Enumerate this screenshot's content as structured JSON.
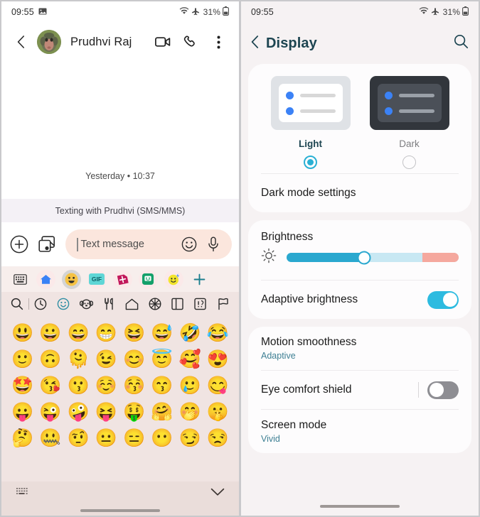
{
  "messages_screen": {
    "status_bar": {
      "time": "09:55",
      "icons": [
        "image-icon",
        "wifi-icon",
        "airplane-icon"
      ],
      "battery_percent": "31%"
    },
    "header": {
      "back_icon": "chevron-left-icon",
      "contact_name": "Prudhvi Raj",
      "avatar": "contact-avatar",
      "actions": [
        "video-call-icon",
        "voice-call-icon",
        "overflow-menu-icon"
      ]
    },
    "thread": {
      "day_separator": "Yesterday • 10:37",
      "sms_banner": "Texting with Prudhvi (SMS/MMS)"
    },
    "compose": {
      "attach_icon": "plus-circle-icon",
      "gallery_icon": "gallery-icon",
      "placeholder": "Text message",
      "emoji_icon": "emoji-face-icon",
      "mic_icon": "microphone-icon"
    },
    "keyboard_toolbar": [
      {
        "name": "keyboard-icon",
        "glyph": "⌨",
        "bg": "transparent",
        "fg": "#2b2b2b",
        "selected": false
      },
      {
        "name": "home-icon",
        "glyph": "⌂",
        "bg": "#fbe9e9",
        "fg": "#3b82f6",
        "selected": false
      },
      {
        "name": "emoji-icon",
        "glyph": "😀",
        "bg": "#d4d4d4",
        "fg": "#000000",
        "selected": true
      },
      {
        "name": "gif-icon",
        "glyph": "GIF",
        "bg": "#fbe9e9",
        "fg": "#1c9aa8",
        "selected": false
      },
      {
        "name": "sticker-icon",
        "glyph": "✿",
        "bg": "#fbe9e9",
        "fg": "#c2185b",
        "selected": false
      },
      {
        "name": "bitmoji-icon",
        "glyph": "☺",
        "bg": "#fbe9e9",
        "fg": "#14a06a",
        "selected": false
      },
      {
        "name": "ai-emoji-icon",
        "glyph": "☻",
        "bg": "#fbe9e9",
        "fg": "#e6c700",
        "selected": false
      },
      {
        "name": "add-icon",
        "glyph": "+",
        "bg": "transparent",
        "fg": "#1c7f8e",
        "selected": false
      }
    ],
    "emoji_categories": [
      {
        "name": "emoji-search-icon",
        "glyph": "search",
        "selected": false
      },
      {
        "name": "recent-icon",
        "glyph": "clock",
        "selected": false
      },
      {
        "name": "smileys-icon",
        "glyph": "smiley",
        "selected": true
      },
      {
        "name": "animals-icon",
        "glyph": "animal",
        "selected": false
      },
      {
        "name": "food-icon",
        "glyph": "food",
        "selected": false
      },
      {
        "name": "travel-icon",
        "glyph": "house",
        "selected": false
      },
      {
        "name": "activities-icon",
        "glyph": "ball",
        "selected": false
      },
      {
        "name": "objects-icon",
        "glyph": "book",
        "selected": false
      },
      {
        "name": "symbols-icon",
        "glyph": "symbols",
        "selected": false
      },
      {
        "name": "flags-icon",
        "glyph": "flag",
        "selected": false
      }
    ],
    "emoji_grid": [
      "😃",
      "😀",
      "😄",
      "😁",
      "😆",
      "😅",
      "🤣",
      "😂",
      "🙂",
      "🙃",
      "🫠",
      "😉",
      "😊",
      "😇",
      "🥰",
      "😍",
      "🤩",
      "😘",
      "😗",
      "☺️",
      "😚",
      "😙",
      "🥲",
      "😋",
      "😛",
      "😜",
      "🤪",
      "😝",
      "🤑",
      "🤗",
      "🤭",
      "🤫",
      "🤔",
      "🤐",
      "🤨",
      "😐",
      "😑",
      "😶",
      "😏",
      "😒"
    ],
    "keyboard_bottom": {
      "layout_icon": "keyboard-layout-icon",
      "collapse_icon": "chevron-down-icon"
    }
  },
  "display_screen": {
    "status_bar": {
      "time": "09:55",
      "battery_percent": "31%"
    },
    "header": {
      "back_icon": "chevron-left-icon",
      "title": "Display",
      "search_icon": "search-icon"
    },
    "theme": {
      "options": [
        {
          "label": "Light",
          "selected": true
        },
        {
          "label": "Dark",
          "selected": false
        }
      ],
      "dark_mode_settings": "Dark mode settings"
    },
    "brightness": {
      "label": "Brightness",
      "icon": "brightness-sun-icon",
      "value_percent": 45,
      "warm_zone_percent": 21
    },
    "rows": [
      {
        "label": "Adaptive brightness",
        "type": "toggle",
        "value": true
      },
      {
        "label": "Motion smoothness",
        "type": "value",
        "value": "Adaptive"
      },
      {
        "label": "Eye comfort shield",
        "type": "toggle",
        "value": false
      },
      {
        "label": "Screen mode",
        "type": "value",
        "value": "Vivid"
      }
    ]
  },
  "colors": {
    "accent_teal": "#2aa8cf",
    "title_teal": "#1d4551",
    "sub_teal": "#3d7f93",
    "compose_bg": "#fbe6dd",
    "keyboard_bg": "#f0e4e2",
    "toggle_off": "#8e8e93"
  }
}
